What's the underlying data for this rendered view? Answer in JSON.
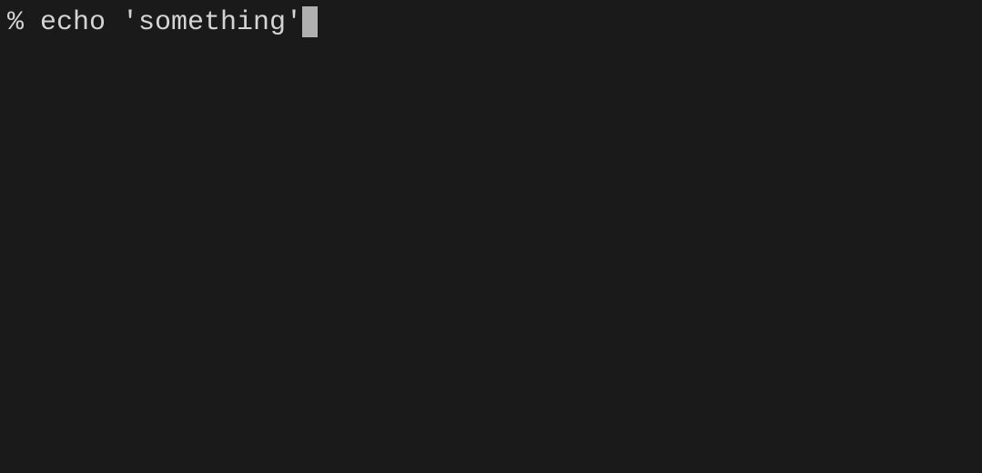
{
  "terminal": {
    "prompt": "% ",
    "command": "echo 'something'"
  }
}
